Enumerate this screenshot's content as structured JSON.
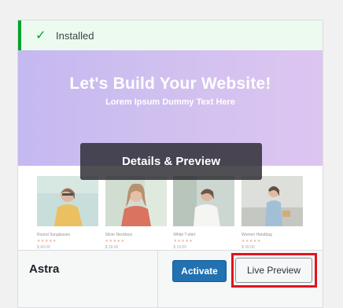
{
  "notice": {
    "text": "Installed",
    "icon": "checkmark-icon"
  },
  "preview": {
    "headline": "Let's Build Your Website!",
    "subheadline": "Lorem Ipsum Dummy Text Here",
    "details_label": "Details & Preview",
    "products": [
      {
        "name": "Round Sunglasses",
        "stars": "★★★★★",
        "price": "$ 49.00"
      },
      {
        "name": "Silver Necklace",
        "stars": "★★★★★",
        "price": "$ 29.00"
      },
      {
        "name": "White T-shirt",
        "stars": "★★★★★",
        "price": "$ 19.00"
      },
      {
        "name": "Women Handbag",
        "stars": "★★★★★",
        "price": "$ 39.00"
      }
    ]
  },
  "footer": {
    "theme_name": "Astra",
    "activate_label": "Activate",
    "live_preview_label": "Live Preview"
  },
  "colors": {
    "accent": "#2271b1",
    "success": "#00a32a",
    "highlight": "#e0141e"
  }
}
